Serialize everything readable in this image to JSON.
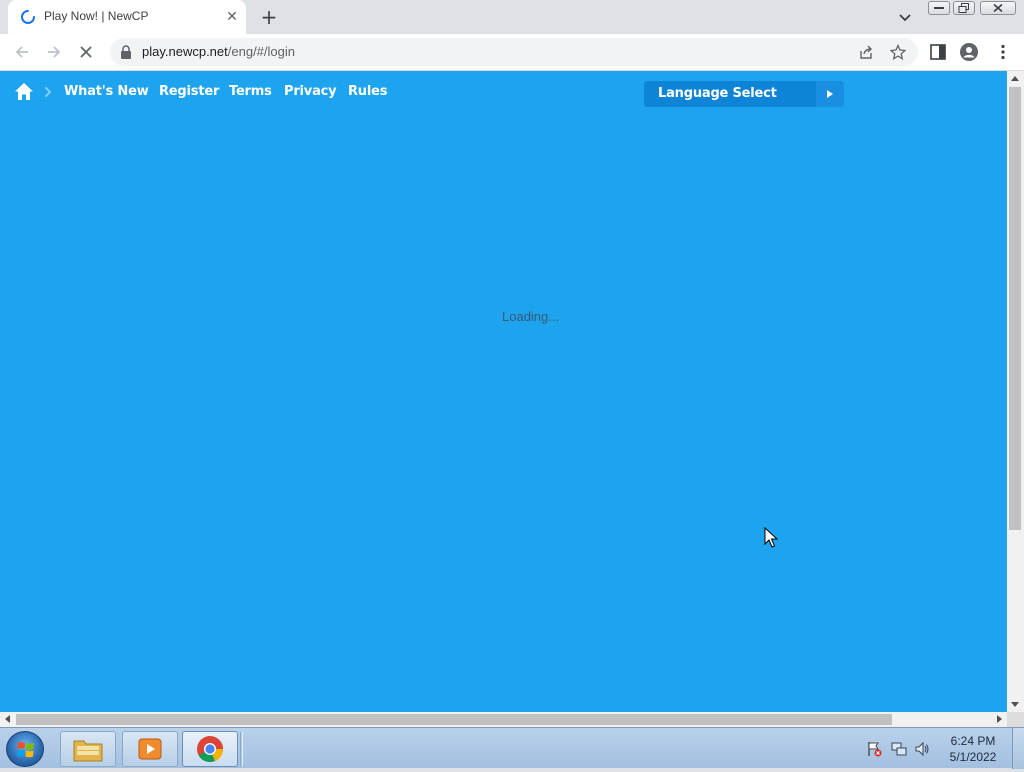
{
  "browser": {
    "tab": {
      "title": "Play Now! | NewCP",
      "close_glyph": "✕"
    },
    "new_tab_glyph": "+",
    "address": {
      "host": "play.newcp.net",
      "path": "/eng/#/login"
    }
  },
  "site": {
    "nav": [
      {
        "label": "What's New"
      },
      {
        "label": "Register"
      },
      {
        "label": "Terms"
      },
      {
        "label": "Privacy"
      },
      {
        "label": "Rules"
      }
    ],
    "language_select": "Language Select",
    "loading": "Loading...",
    "background_color": "#1ea3ee",
    "accent_color": "#0d84d6"
  },
  "taskbar": {
    "clock": {
      "time": "6:24 PM",
      "date": "5/1/2022"
    }
  }
}
